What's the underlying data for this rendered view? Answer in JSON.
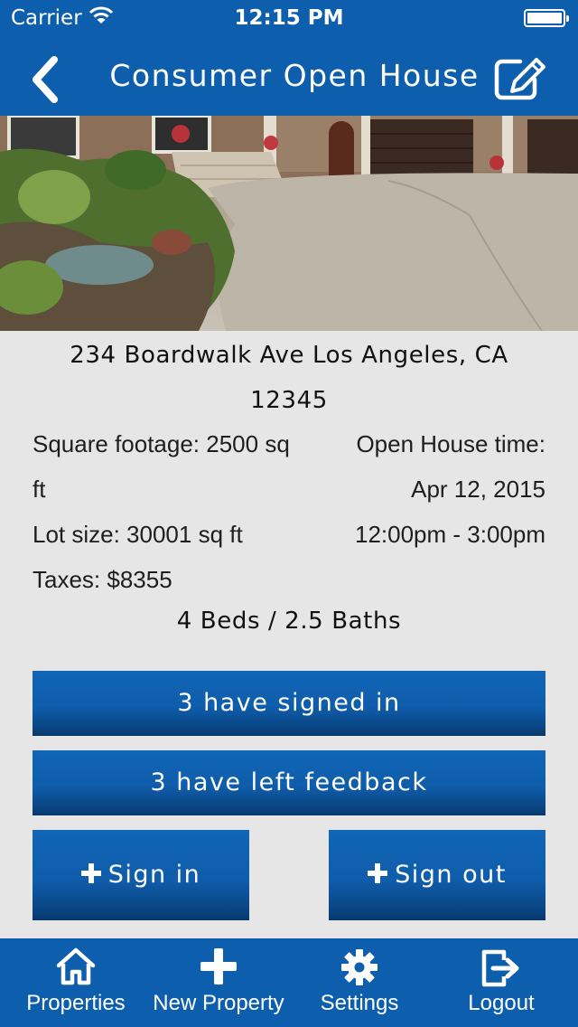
{
  "status_bar": {
    "carrier": "Carrier",
    "time": "12:15 PM"
  },
  "nav": {
    "title": "Consumer Open House",
    "back_icon": "chevron-left-icon",
    "edit_icon": "edit-icon"
  },
  "property": {
    "address_line1": "234 Boardwalk Ave Los Angeles, CA",
    "address_line2": "12345",
    "square_footage_line1": "Square footage: 2500 sq",
    "square_footage_line2": "ft",
    "lot_size": "Lot size: 30001 sq ft",
    "taxes": "Taxes: $8355",
    "open_house_label": "Open House time:",
    "open_house_date": "Apr 12, 2015",
    "open_house_hours": "12:00pm - 3:00pm",
    "beds_baths": "4 Beds / 2.5 Baths"
  },
  "actions": {
    "signed_in": "3 have signed in",
    "left_feedback": "3 have left feedback",
    "sign_in": "Sign in",
    "sign_out": "Sign out"
  },
  "tabbar": {
    "items": [
      {
        "label": "Properties",
        "icon": "home-icon"
      },
      {
        "label": "New Property",
        "icon": "plus-icon"
      },
      {
        "label": "Settings",
        "icon": "gear-icon"
      },
      {
        "label": "Logout",
        "icon": "logout-icon"
      }
    ]
  },
  "colors": {
    "brand_blue": "#0d5fae",
    "background": "#e6e6e6"
  }
}
